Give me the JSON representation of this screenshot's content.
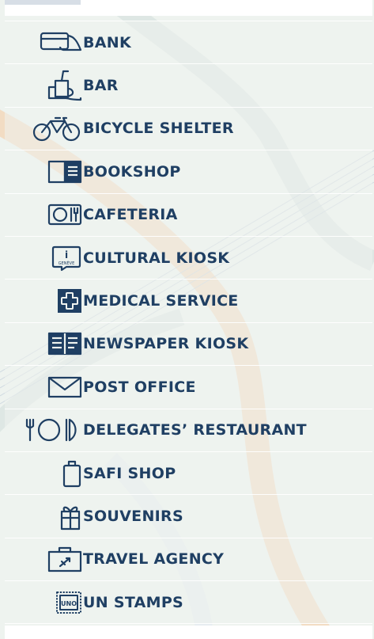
{
  "colors": {
    "text": "#1f3f63",
    "icon": "#1f3f63",
    "background": "#eef3ef",
    "accent_orange": "#f3d2b0"
  },
  "services": [
    {
      "label": "BANK",
      "icon": "bank-card-icon"
    },
    {
      "label": "BAR",
      "icon": "bar-cup-icon"
    },
    {
      "label": "BICYCLE SHELTER",
      "icon": "bicycle-icon"
    },
    {
      "label": "BOOKSHOP",
      "icon": "book-icon"
    },
    {
      "label": "CAFETERIA",
      "icon": "cafeteria-plate-icon"
    },
    {
      "label": "CULTURAL KIOSK",
      "icon": "geneve-info-icon",
      "icon_text": [
        "i",
        "GENÈVE"
      ]
    },
    {
      "label": "MEDICAL SERVICE",
      "icon": "medical-cross-icon"
    },
    {
      "label": "NEWSPAPER KIOSK",
      "icon": "newspaper-icon"
    },
    {
      "label": "POST OFFICE",
      "icon": "envelope-icon"
    },
    {
      "label": "DELEGATES’ RESTAURANT",
      "icon": "restaurant-icon"
    },
    {
      "label": "SAFI SHOP",
      "icon": "shopping-bag-icon"
    },
    {
      "label": "SOUVENIRS",
      "icon": "gift-icon"
    },
    {
      "label": "TRAVEL AGENCY",
      "icon": "suitcase-plane-icon"
    },
    {
      "label": "UN STAMPS",
      "icon": "stamp-icon",
      "icon_text": [
        "UNO"
      ]
    }
  ]
}
